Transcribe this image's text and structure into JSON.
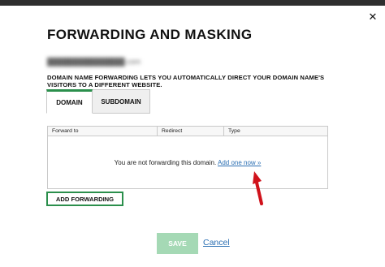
{
  "dialog": {
    "title": "FORWARDING AND MASKING",
    "close_symbol": "✕",
    "domain_name": "███████████████.com",
    "description": "DOMAIN NAME FORWARDING LETS YOU AUTOMATICALLY DIRECT YOUR DOMAIN NAME'S VISITORS TO A DIFFERENT WEBSITE."
  },
  "tabs": [
    {
      "label": "DOMAIN",
      "active": true
    },
    {
      "label": "SUBDOMAIN",
      "active": false
    }
  ],
  "table": {
    "columns": [
      "Forward to",
      "Redirect",
      "Type"
    ],
    "empty_message": "You are not forwarding this domain.",
    "add_link": "Add one now »"
  },
  "buttons": {
    "add_forwarding": "ADD FORWARDING",
    "save": "SAVE",
    "cancel": "Cancel"
  },
  "colors": {
    "accent_green": "#2b8f4c",
    "save_disabled": "#a5d9b5",
    "link_blue": "#2b6fb3",
    "annotation_arrow": "#d0121b"
  },
  "icons": {
    "close": "close-icon",
    "annotation": "red-arrow-icon"
  }
}
